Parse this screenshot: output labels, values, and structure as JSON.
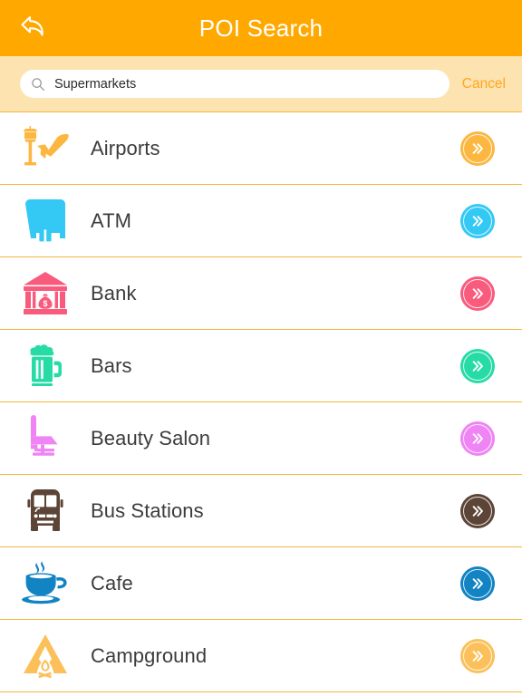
{
  "navbar": {
    "title": "POI Search",
    "back_icon": "back-arrow-icon",
    "background": "#ffa800",
    "title_color": "#ffffff"
  },
  "search": {
    "icon": "search-icon",
    "value": "Supermarkets",
    "placeholder": "Search",
    "cancel_label": "Cancel",
    "cancel_color": "#ffa51f",
    "background": "#fde3b0"
  },
  "list": {
    "separator_color": "#f5b63c",
    "label_color": "#3c3c3c",
    "items": [
      {
        "label": "Airports",
        "icon": "airport-icon",
        "color": "#fcb741",
        "chevron": "double-chevron-right-icon"
      },
      {
        "label": "ATM",
        "icon": "atm-icon",
        "color": "#33c9f4",
        "chevron": "double-chevron-right-icon"
      },
      {
        "label": "Bank",
        "icon": "bank-icon",
        "color": "#f95b7c",
        "chevron": "double-chevron-right-icon"
      },
      {
        "label": "Bars",
        "icon": "beer-mug-icon",
        "color": "#27dba6",
        "chevron": "double-chevron-right-icon"
      },
      {
        "label": "Beauty Salon",
        "icon": "salon-chair-icon",
        "color": "#ef84f5",
        "chevron": "double-chevron-right-icon"
      },
      {
        "label": "Bus Stations",
        "icon": "bus-icon",
        "color": "#5c4436",
        "chevron": "double-chevron-right-icon"
      },
      {
        "label": "Cafe",
        "icon": "coffee-cup-icon",
        "color": "#1283c3",
        "chevron": "double-chevron-right-icon"
      },
      {
        "label": "Campground",
        "icon": "tent-icon",
        "color": "#fbc05a",
        "chevron": "double-chevron-right-icon"
      }
    ]
  }
}
